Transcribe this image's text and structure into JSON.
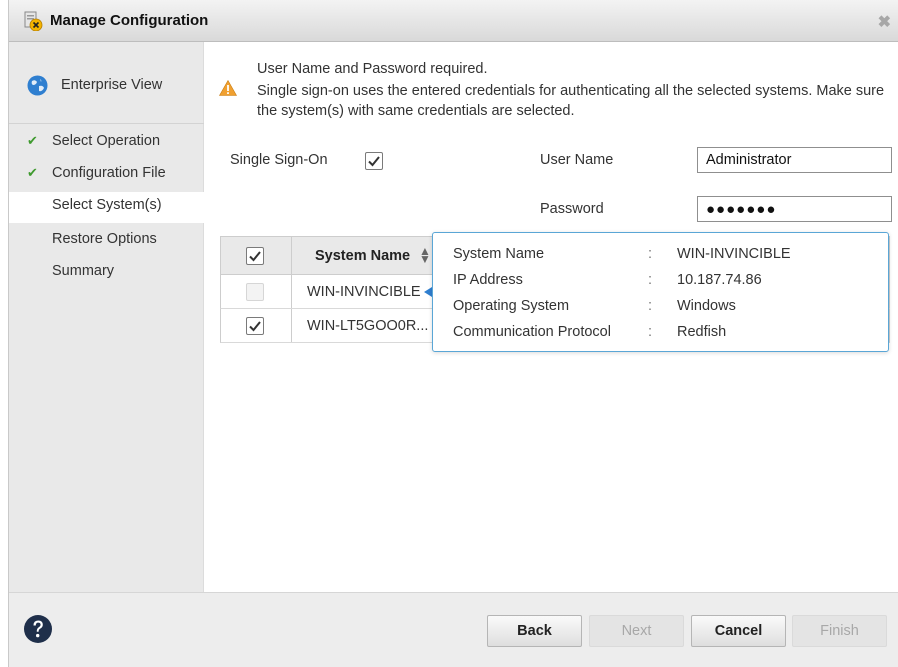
{
  "window": {
    "title": "Manage Configuration",
    "close_glyph": "✖"
  },
  "nav": {
    "enterprise_label": "Enterprise View",
    "items": [
      {
        "label": "Select Operation",
        "done": true
      },
      {
        "label": "Configuration File",
        "done": true
      },
      {
        "label": "Select System(s)",
        "done": false,
        "selected": true
      },
      {
        "label": "Restore Options",
        "done": false
      },
      {
        "label": "Summary",
        "done": false
      }
    ]
  },
  "warning": {
    "line1": "User Name and Password required.",
    "line2": "Single sign-on uses the entered credentials for authenticating all the selected systems. Make sure the system(s) with same credentials are selected."
  },
  "form": {
    "sso_label": "Single Sign-On",
    "sso_checked": true,
    "username_label": "User Name",
    "username_value": "Administrator",
    "password_label": "Password",
    "password_value": "●●●●●●●"
  },
  "table": {
    "header_all_checked": true,
    "column_system_name": "System Name",
    "rows": [
      {
        "name": "WIN-INVINCIBLE",
        "checked": false,
        "disabled": true
      },
      {
        "name": "WIN-LT5GOO0R...",
        "checked": true,
        "disabled": false
      }
    ]
  },
  "popover": {
    "separator": ":",
    "rows": [
      {
        "key": "System Name",
        "value": "WIN-INVINCIBLE"
      },
      {
        "key": "IP Address",
        "value": "10.187.74.86"
      },
      {
        "key": "Operating System",
        "value": "Windows"
      },
      {
        "key": "Communication Protocol",
        "value": "Redfish"
      }
    ]
  },
  "footer": {
    "back": "Back",
    "next": "Next",
    "cancel": "Cancel",
    "finish": "Finish"
  },
  "colors": {
    "check_green": "#3f9a2f",
    "popover_border": "#5aa6d6",
    "warning_orange": "#f0a030"
  },
  "icons": [
    "app-icon",
    "close-icon",
    "globe-icon",
    "check-icon",
    "warning-icon",
    "sort-icon",
    "info-icon",
    "help-icon"
  ]
}
